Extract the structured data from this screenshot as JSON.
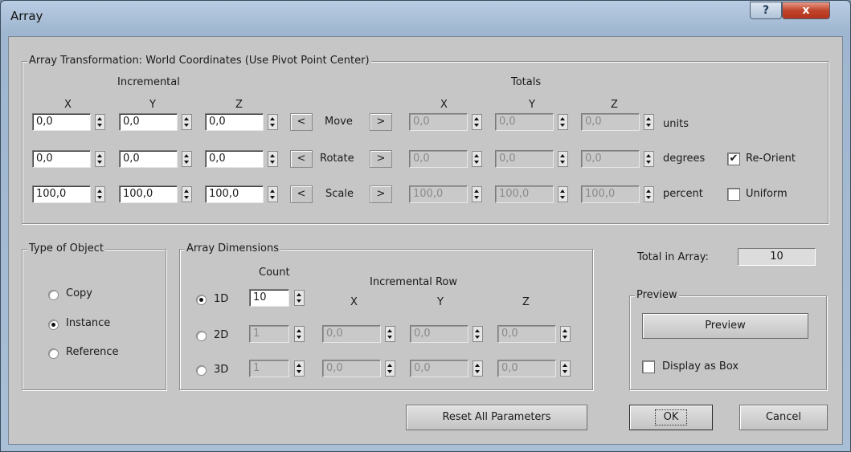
{
  "window": {
    "title": "Array",
    "help_label": "?",
    "close_label": "x"
  },
  "transform": {
    "group_label": "Array Transformation: World Coordinates (Use Pivot Point Center)",
    "incremental_label": "Incremental",
    "totals_label": "Totals",
    "x": "X",
    "y": "Y",
    "z": "Z",
    "left_arrow": "<",
    "right_arrow": ">",
    "rows": [
      {
        "label": "Move",
        "inc": [
          "0,0",
          "0,0",
          "0,0"
        ],
        "tot": [
          "0,0",
          "0,0",
          "0,0"
        ],
        "unit": "units"
      },
      {
        "label": "Rotate",
        "inc": [
          "0,0",
          "0,0",
          "0,0"
        ],
        "tot": [
          "0,0",
          "0,0",
          "0,0"
        ],
        "unit": "degrees"
      },
      {
        "label": "Scale",
        "inc": [
          "100,0",
          "100,0",
          "100,0"
        ],
        "tot": [
          "100,0",
          "100,0",
          "100,0"
        ],
        "unit": "percent"
      }
    ],
    "reorient_label": "Re-Orient",
    "reorient_check": "✔",
    "uniform_label": "Uniform"
  },
  "type_of_object": {
    "group_label": "Type of Object",
    "options": [
      "Copy",
      "Instance",
      "Reference"
    ],
    "selected": "Instance"
  },
  "dimensions": {
    "group_label": "Array Dimensions",
    "count_label": "Count",
    "incremental_row_label": "Incremental Row",
    "x": "X",
    "y": "Y",
    "z": "Z",
    "rows": [
      {
        "label": "1D",
        "count": "10",
        "vals": []
      },
      {
        "label": "2D",
        "count": "1",
        "vals": [
          "0,0",
          "0,0",
          "0,0"
        ]
      },
      {
        "label": "3D",
        "count": "1",
        "vals": [
          "0,0",
          "0,0",
          "0,0"
        ]
      }
    ]
  },
  "total_in_array": {
    "label": "Total in Array:",
    "value": "10"
  },
  "preview": {
    "group_label": "Preview",
    "button_label": "Preview",
    "display_box_label": "Display as Box"
  },
  "buttons": {
    "reset": "Reset All Parameters",
    "ok": "OK",
    "cancel": "Cancel"
  }
}
